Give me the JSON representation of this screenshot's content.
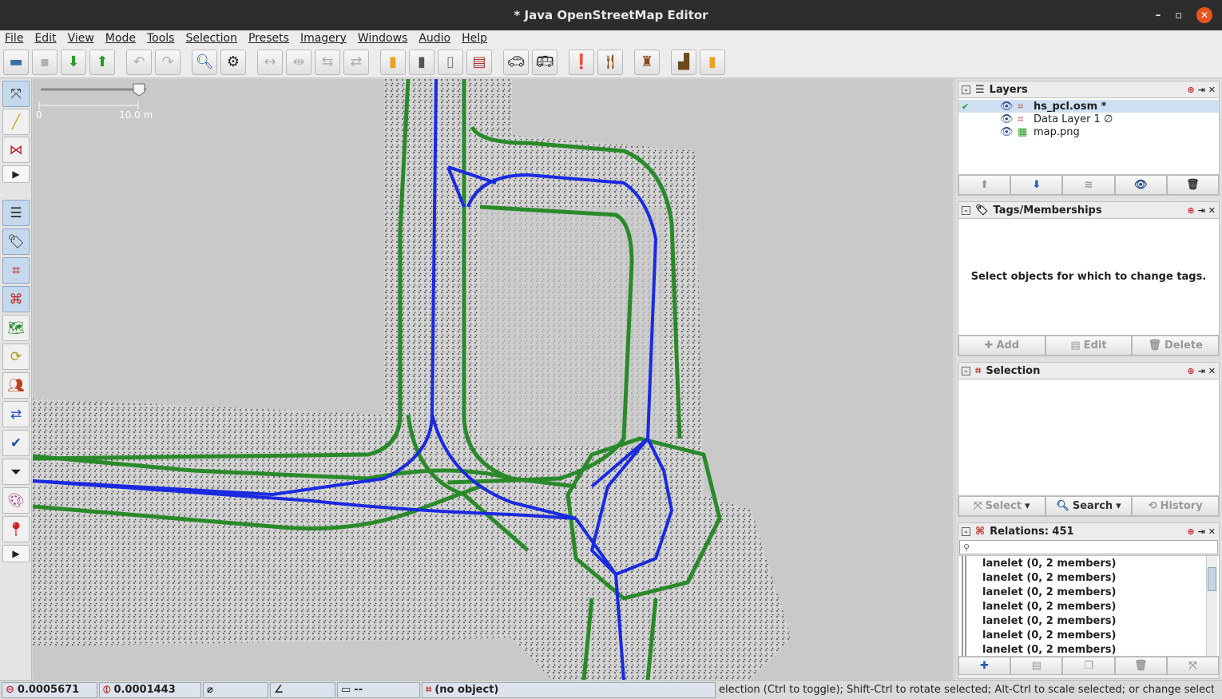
{
  "window": {
    "title": "* Java OpenStreetMap Editor",
    "minimize": "–",
    "maximize": "▫",
    "close": "✕"
  },
  "menu": [
    "File",
    "Edit",
    "View",
    "Mode",
    "Tools",
    "Selection",
    "Presets",
    "Imagery",
    "Windows",
    "Audio",
    "Help"
  ],
  "map": {
    "scale_start": "0",
    "scale_end": "10.0 m"
  },
  "layers_panel": {
    "title": "Layers",
    "items": [
      {
        "name": "hs_pcl.osm *",
        "active": true,
        "type": "data"
      },
      {
        "name": "Data Layer 1 ∅",
        "active": false,
        "type": "data"
      },
      {
        "name": "map.png",
        "active": false,
        "type": "image"
      }
    ]
  },
  "tags_panel": {
    "title": "Tags/Memberships",
    "message": "Select objects for which to change tags.",
    "add_label": "Add",
    "edit_label": "Edit",
    "delete_label": "Delete"
  },
  "selection_panel": {
    "title": "Selection",
    "select_label": "Select",
    "search_label": "Search",
    "history_label": "History"
  },
  "relations_panel": {
    "title": "Relations: 451",
    "filter_placeholder": "",
    "items": [
      "lanelet (0, 2 members)",
      "lanelet (0, 2 members)",
      "lanelet (0, 2 members)",
      "lanelet (0, 2 members)",
      "lanelet (0, 2 members)",
      "lanelet (0, 2 members)",
      "lanelet (0, 2 members)"
    ]
  },
  "status": {
    "lat": "0.0005671",
    "lon": "0.0001443",
    "heading": "",
    "angle": "",
    "length": "--",
    "object": "(no object)",
    "help": "election (Ctrl to toggle); Shift-Ctrl to rotate selected; Alt-Ctrl to scale selected; or change selection"
  }
}
